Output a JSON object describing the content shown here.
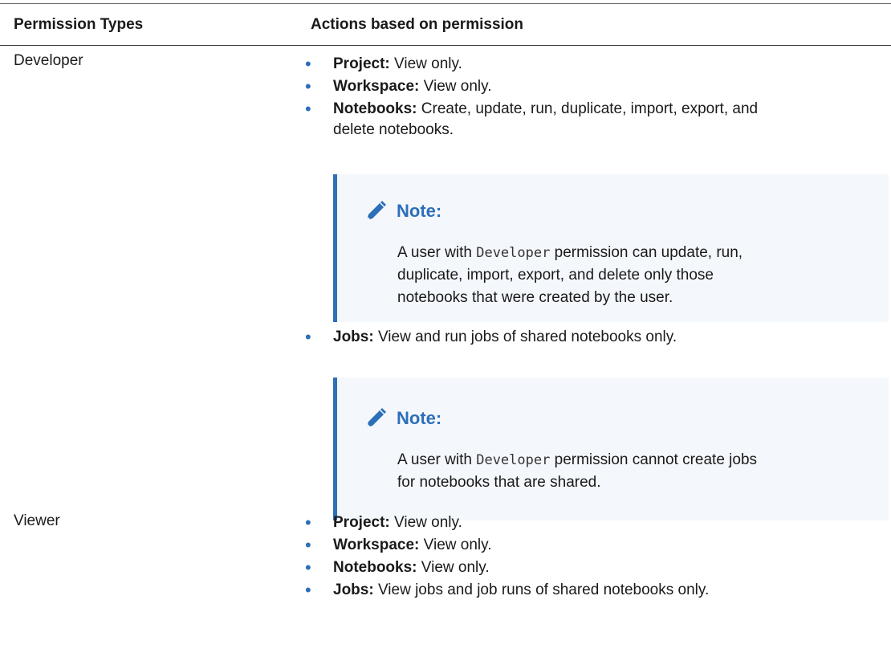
{
  "table": {
    "headers": [
      "Permission Types",
      "Actions based on permission"
    ],
    "rows": [
      {
        "type": "Developer",
        "items": [
          {
            "label": "Project:",
            "text": " View only."
          },
          {
            "label": "Workspace:",
            "text": " View only."
          },
          {
            "label": "Notebooks:",
            "text_line1": " Create, update, run, duplicate, import, export, and",
            "text_line2": "delete notebooks."
          },
          {
            "label": "Jobs:",
            "text": " View and run jobs of shared notebooks only."
          }
        ],
        "notes": [
          {
            "title": "Note:",
            "pre": "A user with ",
            "code": "Developer",
            "line1_rest": " permission can update, run,",
            "line2": "duplicate, import, export, and delete only those",
            "line3": "notebooks that were created by the user."
          },
          {
            "title": "Note:",
            "pre": "A user with ",
            "code": "Developer",
            "line1_rest": " permission cannot create jobs",
            "line2": "for notebooks that are shared."
          }
        ]
      },
      {
        "type": "Viewer",
        "items": [
          {
            "label": "Project:",
            "text": " View only."
          },
          {
            "label": "Workspace:",
            "text": " View only."
          },
          {
            "label": "Notebooks:",
            "text": " View only."
          },
          {
            "label": "Jobs:",
            "text": " View jobs and job runs of shared notebooks only."
          }
        ]
      }
    ]
  },
  "colors": {
    "accent": "#2d6fb8",
    "note_bg": "#f4f8fc",
    "text": "#1a1a1a"
  },
  "icons": {
    "note": "pencil-icon",
    "bullet": "bullet-dot"
  }
}
